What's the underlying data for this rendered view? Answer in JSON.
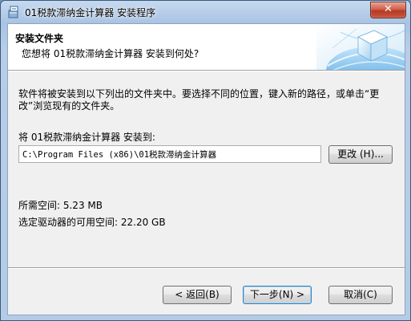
{
  "window": {
    "title": "01税款滞纳金计算器 安装程序",
    "close_glyph": "✕"
  },
  "header": {
    "title": "安装文件夹",
    "subtitle": "您想将 01税款滞纳金计算器 安装到何处?"
  },
  "body": {
    "description": "软件将被安装到以下列出的文件夹中。要选择不同的位置，键入新的路径，或单击“更改”浏览现有的文件夹。",
    "install_label": "将 01税款滞纳金计算器 安装到:",
    "install_path": "C:\\Program Files (x86)\\01税款滞纳金计算器",
    "browse_label": "更改 (H)...",
    "space_required": "所需空间: 5.23 MB",
    "space_available": "选定驱动器的可用空间: 22.20 GB"
  },
  "footer": {
    "back_label": "< 返回(B)",
    "next_label": "下一步(N) >",
    "cancel_label": "取消(C)"
  },
  "icons": {
    "app": "installer-box-icon",
    "header_art": "globe-cube-icon"
  },
  "colors": {
    "title_bar": "#b7cde8",
    "close_button": "#c8563f",
    "client_bg": "#f0f0f0",
    "default_button_border": "#3c7fb1"
  }
}
